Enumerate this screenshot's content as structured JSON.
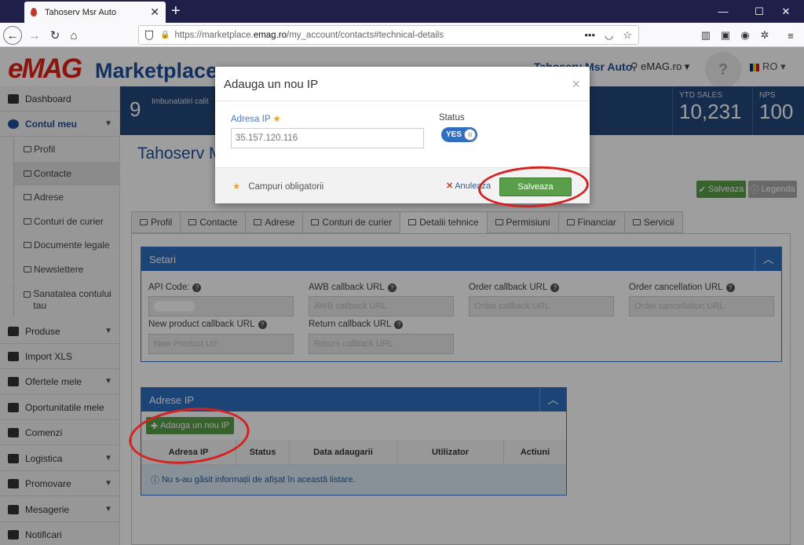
{
  "browser": {
    "tab_title": "Tahoserv Msr Auto",
    "url_prefix": "https://marketplace.",
    "url_domain": "emag.ro",
    "url_path": "/my_account/contacts#technical-details",
    "new_tab": "+",
    "minimize": "—",
    "maximize": "☐",
    "close": "✕"
  },
  "header": {
    "logo": "eMAG",
    "logo_sub": "Marketplace",
    "user_name": "Tahoserv Msr Auto",
    "store": "eMAG.ro ▾",
    "help": "?",
    "lang": "RO ▾"
  },
  "sidebar": {
    "items": [
      {
        "label": "Dashboard"
      },
      {
        "label": "Contul meu"
      },
      {
        "label": "Profil"
      },
      {
        "label": "Contacte"
      },
      {
        "label": "Adrese"
      },
      {
        "label": "Conturi de curier"
      },
      {
        "label": "Documente legale"
      },
      {
        "label": "Newslettere"
      },
      {
        "label": "Sanatatea contului tau"
      },
      {
        "label": "Produse"
      },
      {
        "label": "Import XLS"
      },
      {
        "label": "Ofertele mele"
      },
      {
        "label": "Oportunitatile mele"
      },
      {
        "label": "Comenzi"
      },
      {
        "label": "Logistica"
      },
      {
        "label": "Promovare"
      },
      {
        "label": "Mesagerie"
      },
      {
        "label": "Notificari"
      }
    ]
  },
  "stats": {
    "count": "9",
    "text": "Imbunatatiri calit",
    "ytd_label": "YTD SALES",
    "ytd_value": "10,231",
    "nps_label": "NPS",
    "nps_value": "100"
  },
  "content": {
    "title": "Tahoserv M",
    "save_btn": "Salveaza",
    "legend_btn": "Legenda",
    "tabs": [
      "Profil",
      "Contacte",
      "Adrese",
      "Conturi de curier",
      "Detalii tehnice",
      "Permisiuni",
      "Financiar",
      "Servicii"
    ],
    "settings": {
      "title": "Setari",
      "api_code_label": "API Code:",
      "awb_label": "AWB callback URL",
      "awb_placeholder": "AWB callback URL",
      "order_label": "Order callback URL",
      "order_placeholder": "Order callback URL",
      "cancel_label": "Order cancellation URL",
      "cancel_placeholder": "Order cancellation URL",
      "newprod_label": "New product callback URL",
      "newprod_placeholder": "New Product Url",
      "return_label": "Return callback URL",
      "return_placeholder": "Return callback URL"
    },
    "ip": {
      "title": "Adrese IP",
      "add_btn": "Adauga un nou IP",
      "columns": [
        "Adresa IP",
        "Status",
        "Data adaugarii",
        "Utilizator",
        "Actiuni"
      ],
      "empty": "Nu s-au găsit informații de afișat în această listare."
    }
  },
  "modal": {
    "title": "Adauga un nou IP",
    "close": "×",
    "ip_label": "Adresa IP",
    "ip_value": "35.157.120.116",
    "status_label": "Status",
    "toggle": "YES",
    "required": "Campuri obligatorii",
    "cancel": "Anuleaza",
    "save": "Salveaza"
  },
  "colors": {
    "brand_blue": "#1d4e9b",
    "panel_blue": "#2f6ec0",
    "save_green": "#5a9e4a",
    "annotation_red": "#d42222"
  }
}
